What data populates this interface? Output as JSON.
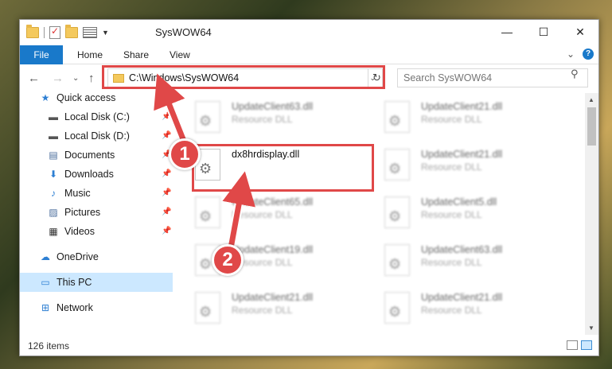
{
  "window": {
    "title": "SysWOW64",
    "controls": {
      "minimize": "—",
      "maximize": "☐",
      "close": "✕"
    }
  },
  "ribbon": {
    "tabs": [
      "File",
      "Home",
      "Share",
      "View"
    ],
    "expand_glyph": "⌄",
    "help_glyph": "?"
  },
  "address": {
    "path": "C:\\Windows\\SysWOW64",
    "dropdown_glyph": "⌄",
    "refresh_glyph": "↻"
  },
  "search": {
    "placeholder": "Search SysWOW64",
    "icon_glyph": "⚲"
  },
  "nav_buttons": {
    "back": "←",
    "forward": "→",
    "recent": "⌄",
    "up": "↑"
  },
  "nav_pane": {
    "pin_glyph": "📌",
    "items": [
      {
        "label": "Quick access",
        "icon": "star-icon",
        "glyph": "★",
        "color": "#2d7fd3"
      },
      {
        "label": "Local Disk (C:)",
        "icon": "drive-icon",
        "glyph": "▬",
        "color": "#555555"
      },
      {
        "label": "Local Disk (D:)",
        "icon": "drive-icon",
        "glyph": "▬",
        "color": "#555555"
      },
      {
        "label": "Documents",
        "icon": "documents-icon",
        "glyph": "▤",
        "color": "#4a6d9c"
      },
      {
        "label": "Downloads",
        "icon": "downloads-icon",
        "glyph": "⬇",
        "color": "#2d7fd3"
      },
      {
        "label": "Music",
        "icon": "music-icon",
        "glyph": "♪",
        "color": "#2d7fd3"
      },
      {
        "label": "Pictures",
        "icon": "pictures-icon",
        "glyph": "▨",
        "color": "#4a6d9c"
      },
      {
        "label": "Videos",
        "icon": "videos-icon",
        "glyph": "▦",
        "color": "#333333"
      },
      {
        "label": "OneDrive",
        "icon": "onedrive-icon",
        "glyph": "☁",
        "color": "#2d7fd3"
      },
      {
        "label": "This PC",
        "icon": "pc-icon",
        "glyph": "▭",
        "color": "#2d7fd3"
      },
      {
        "label": "Network",
        "icon": "network-icon",
        "glyph": "⊞",
        "color": "#2d7fd3"
      }
    ]
  },
  "files": [
    {
      "name": "UpdateClient63.dll",
      "type": "Resource DLL"
    },
    {
      "name": "UpdateClient21.dll",
      "type": "Resource DLL"
    },
    {
      "name": "dx8hrdisplay.dll",
      "type": ""
    },
    {
      "name": "UpdateClient21.dll",
      "type": "Resource DLL"
    },
    {
      "name": "UpdateClient65.dll",
      "type": "Resource DLL"
    },
    {
      "name": "UpdateClient5.dll",
      "type": "Resource DLL"
    },
    {
      "name": "UpdateClient19.dll",
      "type": "Resource DLL"
    },
    {
      "name": "UpdateClient63.dll",
      "type": "Resource DLL"
    },
    {
      "name": "UpdateClient21.dll",
      "type": "Resource DLL"
    },
    {
      "name": "UpdateClient21.dll",
      "type": "Resource DLL"
    }
  ],
  "status": {
    "item_count": "126 items"
  },
  "callouts": [
    {
      "number": "1"
    },
    {
      "number": "2"
    }
  ],
  "colors": {
    "accent": "#1979ca",
    "highlight": "#e04848",
    "selected_nav": "#cce8ff"
  }
}
